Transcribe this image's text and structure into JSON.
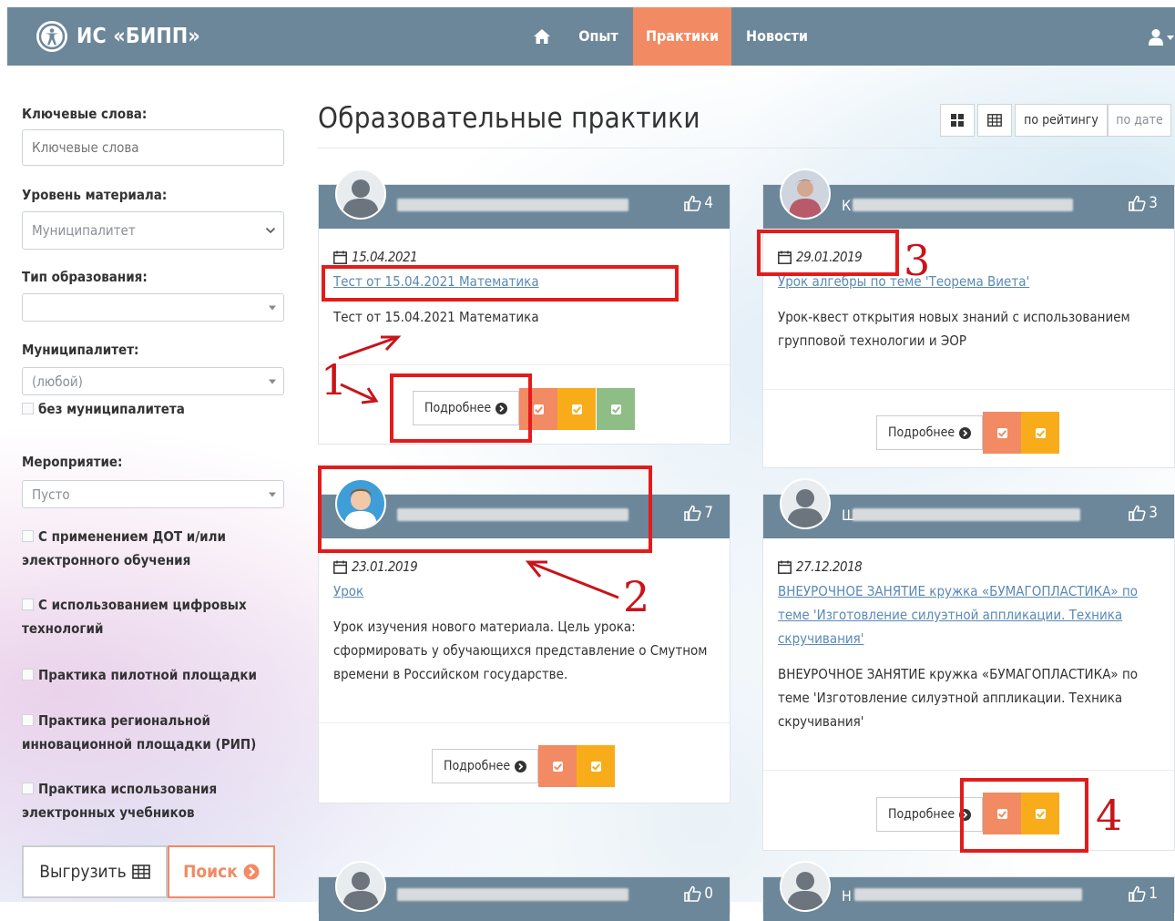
{
  "navbar": {
    "brand": "ИС «БИПП»",
    "items": {
      "opyt": "Опыт",
      "praktiki": "Практики",
      "novosti": "Новости"
    }
  },
  "sidebar": {
    "keywords_label": "Ключевые слова:",
    "keywords_placeholder": "Ключевые слова",
    "level_label": "Уровень материала:",
    "level_value": "Муниципалитет",
    "edu_type_label": "Тип образования:",
    "edu_type_value": "",
    "municipality_label": "Муниципалитет:",
    "municipality_value": "(любой)",
    "no_municipality": "без муниципалитета",
    "event_label": "Мероприятие:",
    "event_value": "Пусто",
    "checks": {
      "dot_line1": "С применением ДОТ и/или",
      "dot_line2": "электронного обучения",
      "digital_line1": "С использованием цифровых",
      "digital_line2": "технологий",
      "pilot": "Практика пилотной площадки",
      "rip_line1": "Практика региональной",
      "rip_line2": "инновационной площадки (РИП)",
      "textbooks_line1": "Практика использования",
      "textbooks_line2": "электронных учебников"
    },
    "export_label": "Выгрузить",
    "search_label": "Поиск"
  },
  "main": {
    "title": "Образовательные практики",
    "sort_rating": "по рейтингу",
    "sort_date": "по дате"
  },
  "cards": [
    {
      "likes": "4",
      "date": "15.04.2021",
      "link": "Тест от 15.04.2021 Математика",
      "desc_line1": "Тест от 15.04.2021 Математика",
      "more": "Подробнее"
    },
    {
      "likes": "3",
      "name_initial": "К",
      "date": "29.01.2019",
      "link": "Урок алгебры по теме 'Теорема Виета'",
      "desc_line1": "Урок-квест открытия новых знаний с использованием",
      "desc_line2": "групповой технологии и ЭОР",
      "more": "Подробнее"
    },
    {
      "likes": "7",
      "date": "23.01.2019",
      "link": "Урок",
      "desc_line1": "Урок изучения нового материала. Цель урока:",
      "desc_line2": "сформировать у обучающихся представление о Смутном",
      "desc_line3": "времени в Российском государстве.",
      "more": "Подробнее"
    },
    {
      "likes": "3",
      "name_initial": "Ш",
      "date": "27.12.2018",
      "link_line1": "ВНЕУРОЧНОЕ ЗАНЯТИЕ кружка «БУМАГОПЛАСТИКА» по",
      "link_line2": "теме 'Изготовление силуэтной аппликации. Техника",
      "link_line3": "скручивания'",
      "desc_line1": "ВНЕУРОЧНОЕ ЗАНЯТИЕ кружка «БУМАГОПЛАСТИКА» по",
      "desc_line2": "теме 'Изготовление силуэтной аппликации. Техника",
      "desc_line3": "скручивания'",
      "more": "Подробнее"
    },
    {
      "likes": "0"
    },
    {
      "likes": "1",
      "name_initial": "Н"
    }
  ],
  "annotations": {
    "n1": "1",
    "n2": "2",
    "n3": "3",
    "n4": "4"
  },
  "colors": {
    "navbar": "#6c8799",
    "accent": "#f28a63",
    "yellow": "#f9ac1a",
    "green": "#8ebd85",
    "link": "#5a8ab5",
    "annotation": "#e41b1b"
  }
}
